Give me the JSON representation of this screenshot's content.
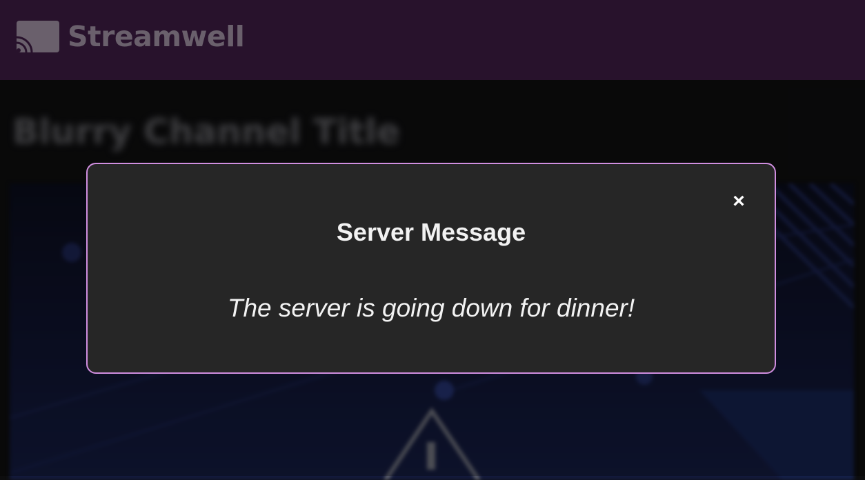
{
  "header": {
    "brand_name": "Streamwell",
    "logo_icon": "cast-icon",
    "background_color": "#3a1a40"
  },
  "channel": {
    "title": "Blurry Channel Title"
  },
  "player": {
    "icon": "warning-triangle-icon"
  },
  "modal": {
    "title": "Server Message",
    "message": "The server is going down for dinner!",
    "close_label": "×",
    "border_color": "#d08ee0",
    "background_color": "#262626"
  }
}
